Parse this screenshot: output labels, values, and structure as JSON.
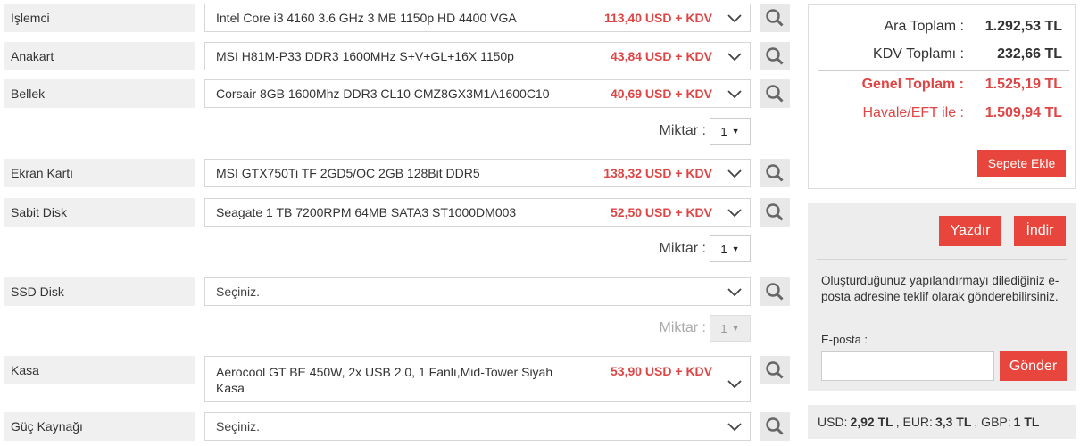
{
  "components": [
    {
      "label": "İşlemci",
      "name": "Intel Core i3 4160 3.6 GHz 3 MB 1150p HD 4400 VGA",
      "price": "113,40 USD + KDV"
    },
    {
      "label": "Anakart",
      "name": "MSI H81M-P33 DDR3 1600MHz S+V+GL+16X 1150p",
      "price": "43,84 USD + KDV"
    },
    {
      "label": "Bellek",
      "name": "Corsair 8GB 1600Mhz DDR3 CL10 CMZ8GX3M1A1600C10",
      "price": "40,69 USD + KDV"
    },
    {
      "label": "Ekran Kartı",
      "name": "MSI GTX750Ti TF 2GD5/OC 2GB 128Bit DDR5",
      "price": "138,32 USD + KDV"
    },
    {
      "label": "Sabit Disk",
      "name": "Seagate 1 TB 7200RPM 64MB SATA3 ST1000DM003",
      "price": "52,50 USD + KDV"
    },
    {
      "label": "SSD Disk",
      "name": "Seçiniz.",
      "price": ""
    },
    {
      "label": "Kasa",
      "name": "Aerocool GT BE 450W, 2x USB 2.0, 1 Fanlı,Mid-Tower Siyah Kasa",
      "price": "53,90 USD + KDV"
    },
    {
      "label": "Güç Kaynağı",
      "name": "Seçiniz.",
      "price": ""
    }
  ],
  "quantity": {
    "label": "Miktar :",
    "memory": "1",
    "hdd": "1",
    "ssd": "1"
  },
  "summary": {
    "subtotal_label": "Ara Toplam :",
    "subtotal_value": "1.292,53 TL",
    "vat_label": "KDV Toplamı :",
    "vat_value": "232,66 TL",
    "grand_label": "Genel Toplam :",
    "grand_value": "1.525,19 TL",
    "transfer_label": "Havale/EFT ile :",
    "transfer_value": "1.509,94 TL",
    "add_to_cart": "Sepete Ekle"
  },
  "actions": {
    "print": "Yazdır",
    "download": "İndir",
    "info": "Oluşturduğunuz yapılandırmayı dilediğiniz e-posta adresine teklif olarak gönderebilirsiniz.",
    "email_label": "E-posta :",
    "email_value": "",
    "send": "Gönder"
  },
  "rates": {
    "usd_label": "USD:",
    "usd": "2,92 TL",
    "eur_label": ", EUR:",
    "eur": "3,3 TL",
    "gbp_label": ", GBP:",
    "gbp": "1 TL"
  },
  "colors": {
    "accent": "#e8453c",
    "price": "#e04545"
  }
}
